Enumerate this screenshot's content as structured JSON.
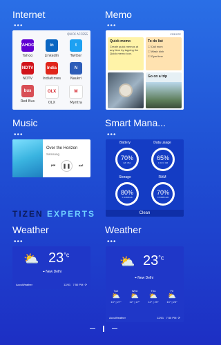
{
  "panels": {
    "internet": {
      "title": "Internet",
      "quick_access": "QUICK ACCESS",
      "apps": [
        {
          "label": "Yahoo",
          "icon": "yahoo-icon",
          "color": "#6001d2",
          "mark": "YAHOO!"
        },
        {
          "label": "LinkedIn",
          "icon": "linkedin-icon",
          "color": "#0a66c2",
          "mark": "in"
        },
        {
          "label": "Twitter",
          "icon": "twitter-icon",
          "color": "#1da1f2",
          "mark": "t"
        },
        {
          "label": "NDTV",
          "icon": "ndtv-icon",
          "color": "#d1121a",
          "mark": "NDTV"
        },
        {
          "label": "Indiatimes",
          "icon": "indiatimes-icon",
          "color": "#e0261b",
          "mark": "India"
        },
        {
          "label": "Naukri",
          "icon": "naukri-icon",
          "color": "#2d5db8",
          "mark": "N"
        },
        {
          "label": "Red Bus",
          "icon": "redbus-icon",
          "color": "#d84e55",
          "mark": "bus"
        },
        {
          "label": "OLX",
          "icon": "olx-icon",
          "color": "#ffffff",
          "mark": "OLX"
        },
        {
          "label": "Myntra",
          "icon": "myntra-icon",
          "color": "#ffffff",
          "mark": "M"
        }
      ]
    },
    "memo": {
      "title": "Memo",
      "create": "CREATE",
      "quick_memo_title": "Quick memo",
      "quick_memo_text": "Create quick memos at any time by tapping the Quick memo icon.",
      "todo_title": "To do list",
      "todo_items": [
        "Call mom",
        "Wash dish",
        "Gym time"
      ],
      "trip_title": "Go on a trip"
    },
    "music": {
      "title": "Music",
      "track": "Over the Horizon",
      "artist": "Samsung"
    },
    "smart": {
      "title": "Smart Mana...",
      "battery_label": "Battery",
      "battery_pct": "70%",
      "battery_sub": "12h 35m",
      "data_label": "Data usage",
      "data_pct": "65%",
      "data_sub": "1.5/2.0 GB",
      "storage_label": "Storage",
      "storage_pct": "80%",
      "storage_sub": "1.4GB/8GB",
      "ram_label": "RAM",
      "ram_pct": "70%",
      "ram_sub": "670MB/1GB",
      "clean_label": "Clean"
    },
    "weather_small": {
      "title": "Weather",
      "temp": "23",
      "unit": "°c",
      "city": "New Delhi",
      "provider": "AccuWeather",
      "date": "12/01",
      "time": "7:50 PM"
    },
    "weather_large": {
      "title": "Weather",
      "temp": "23",
      "unit": "°c",
      "city": "New Delhi",
      "provider": "AccuWeather",
      "date": "12/01",
      "time": "7:50 PM",
      "forecast": [
        {
          "day": "Tue",
          "range": "13° | 27°"
        },
        {
          "day": "Wed",
          "range": "12° | 27°"
        },
        {
          "day": "Thu",
          "range": "12° | 25°"
        },
        {
          "day": "Fri",
          "range": "13° | 25°"
        }
      ]
    }
  },
  "watermark": {
    "part1": "TIZEN",
    "part2": "EXPERTS"
  },
  "colors": {
    "accent": "#1d2fc4",
    "watermark_dark": "#0b1a5a",
    "watermark_light": "#6fd0ff"
  }
}
